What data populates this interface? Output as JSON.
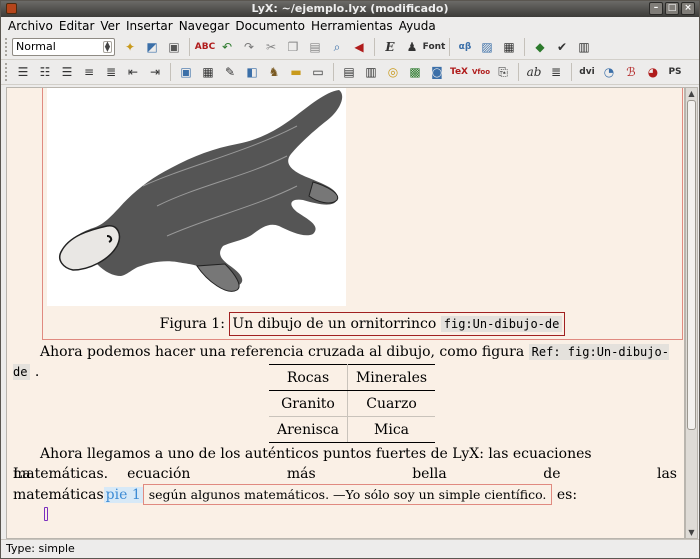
{
  "window": {
    "title": "LyX: ~/ejemplo.lyx (modificado)",
    "buttons": [
      "–",
      "□",
      "×"
    ]
  },
  "menu": [
    "Archivo",
    "Editar",
    "Ver",
    "Insertar",
    "Navegar",
    "Documento",
    "Herramientas",
    "Ayuda"
  ],
  "toolbar": {
    "style_combo": "Normal",
    "font_label": "Font",
    "tex_label": "TeX",
    "vfoo_label": "Vfoo",
    "ps_label": "PS"
  },
  "figure": {
    "caption_prefix": "Figura 1:",
    "caption_text": "Un dibujo de un ornitorrinco",
    "label": "fig:Un-dibujo-de"
  },
  "paragraphs": {
    "ref_text": "Ahora podemos hacer una referencia cruzada al dibujo, como figura",
    "ref_inset": "Ref: fig:Un-dibujo-de",
    "ref_end": ".",
    "eq_line1": "Ahora llegamos a uno de los auténticos puntos fuertes de LyX: las ecuaciones matemáticas.",
    "eq_line2_words": [
      "La",
      "ecuación",
      "más",
      "bella",
      "de",
      "las"
    ],
    "eq_line3_start": "matemáticas",
    "foot_label": "pie 1",
    "foot_text": "según algunos matemáticos. —Yo sólo soy un simple científico.",
    "eq_line3_end": "es:"
  },
  "table": {
    "header": [
      "Rocas",
      "Minerales"
    ],
    "rows": [
      [
        "Granito",
        "Cuarzo"
      ],
      [
        "Arenisca",
        "Mica"
      ]
    ]
  },
  "status": "Type: simple"
}
